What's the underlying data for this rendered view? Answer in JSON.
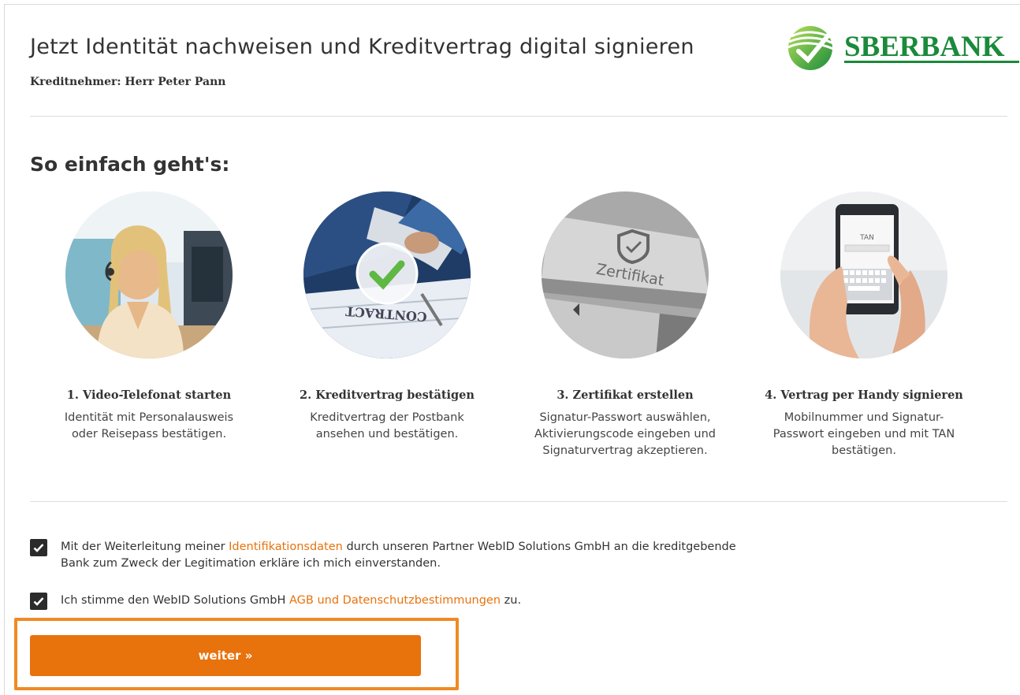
{
  "header": {
    "title": "Jetzt Identität nachweisen und Kreditvertrag digital signieren",
    "borrower": "Kreditnehmer: Herr Peter Pann",
    "logo_text": "SBERBANK"
  },
  "howto": {
    "heading": "So einfach geht's:",
    "steps": [
      {
        "title": "1. Video-Telefonat starten",
        "description": "Identität mit Personalausweis\noder Reisepass bestätigen.",
        "image": "call-center-agent-photo"
      },
      {
        "title": "2. Kreditvertrag bestätigen",
        "description": "Kreditvertrag der Postbank\nansehen und bestätigen.",
        "image": "contract-checkmark-photo",
        "image_text": "CONTRACT"
      },
      {
        "title": "3. Zertifikat erstellen",
        "description": "Signatur-Passwort auswählen,\nAktivierungscode eingeben und\nSignaturvertrag akzeptieren.",
        "image": "certificate-key-photo",
        "image_text": "Zertifikat"
      },
      {
        "title": "4. Vertrag per Handy signieren",
        "description": "Mobilnummer und Signatur-\nPasswort eingeben und mit TAN\nbestätigen.",
        "image": "smartphone-tan-photo",
        "image_text": "TAN"
      }
    ]
  },
  "consents": [
    {
      "checked": true,
      "text_before": "Mit der Weiterleitung meiner ",
      "link": "Identifikationsdaten",
      "text_after": " durch unseren Partner WebID Solutions GmbH an die kreditgebende\nBank zum Zweck der Legitimation erkläre ich mich einverstanden."
    },
    {
      "checked": true,
      "text_before": "Ich stimme den WebID Solutions GmbH ",
      "link": "AGB und Datenschutzbestimmungen",
      "text_after": " zu."
    }
  ],
  "button": {
    "label": "weiter »"
  },
  "colors": {
    "accent": "#e8720c",
    "brand_green": "#1b8a3a",
    "checkbox": "#2b2b2b",
    "text": "#333333"
  }
}
